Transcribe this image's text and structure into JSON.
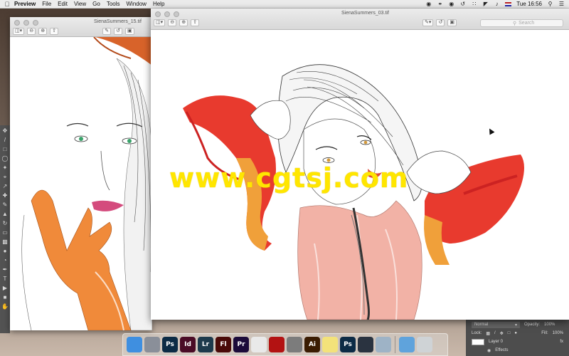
{
  "menubar": {
    "app_name": "Preview",
    "menus": [
      "File",
      "Edit",
      "View",
      "Go",
      "Tools",
      "Window",
      "Help"
    ],
    "clock": "Tue 16:56"
  },
  "window_back": {
    "title": "SienaSummers_15.tif"
  },
  "window_front": {
    "title": "SienaSummers_03.tif",
    "search_placeholder": "Search"
  },
  "watermark": "www.cgtsj.com",
  "photoshop": {
    "blend_mode": "Normal",
    "opacity_label": "Opacity:",
    "opacity_value": "100%",
    "lock_label": "Lock:",
    "fill_label": "Fill:",
    "fill_value": "100%",
    "layer_name": "Layer 0",
    "effects_label": "Effects"
  },
  "dock": {
    "apps": [
      {
        "name": "finder",
        "label": "",
        "color": "#3f8fe0"
      },
      {
        "name": "launchpad",
        "label": "",
        "color": "#8a8f99"
      },
      {
        "name": "photoshop",
        "label": "Ps",
        "color": "#0c2b45"
      },
      {
        "name": "indesign",
        "label": "Id",
        "color": "#4a0b26"
      },
      {
        "name": "lightroom",
        "label": "Lr",
        "color": "#1d3a4c"
      },
      {
        "name": "flash",
        "label": "Fl",
        "color": "#4a0a08"
      },
      {
        "name": "premiere",
        "label": "Pr",
        "color": "#1c0b3a"
      },
      {
        "name": "chrome",
        "label": "",
        "color": "#e9e9e9"
      },
      {
        "name": "acrobat",
        "label": "",
        "color": "#b31212"
      },
      {
        "name": "system-preferences",
        "label": "",
        "color": "#7c7c7c"
      },
      {
        "name": "illustrator",
        "label": "Ai",
        "color": "#3a1c02"
      },
      {
        "name": "notes",
        "label": "",
        "color": "#f3e27a"
      },
      {
        "name": "photoshop-2",
        "label": "Ps",
        "color": "#0c2b45"
      },
      {
        "name": "quicktime",
        "label": "",
        "color": "#2a3340"
      },
      {
        "name": "preview",
        "label": "",
        "color": "#9eb3c6"
      },
      {
        "name": "folder",
        "label": "",
        "color": "#5fa3dc"
      },
      {
        "name": "trash",
        "label": "",
        "color": "#cfd3d6"
      }
    ]
  }
}
